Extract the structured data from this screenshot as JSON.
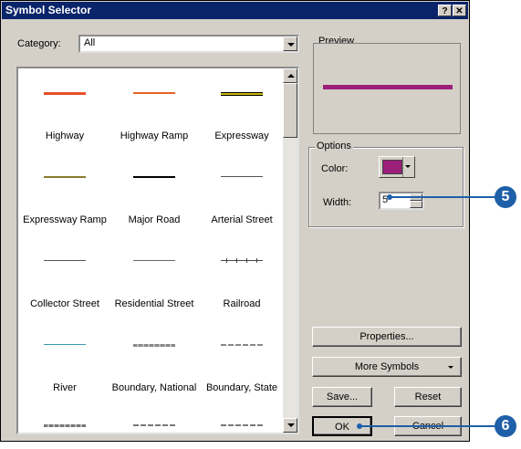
{
  "window": {
    "title": "Symbol Selector",
    "help_btn": "?",
    "close_btn": "✕"
  },
  "category": {
    "label": "Category:",
    "value": "All"
  },
  "symbols": [
    {
      "name": "Highway",
      "color": "#e8502a",
      "style": "thick"
    },
    {
      "name": "Highway Ramp",
      "color": "#e8602a",
      "style": "thin-double"
    },
    {
      "name": "Expressway",
      "color": "#c8b800",
      "style": "cased"
    },
    {
      "name": "Expressway Ramp",
      "color": "#8a7a30",
      "style": "thin-double"
    },
    {
      "name": "Major Road",
      "color": "#000000",
      "style": "medium"
    },
    {
      "name": "Arterial Street",
      "color": "#555555",
      "style": "thin"
    },
    {
      "name": "Collector Street",
      "color": "#555555",
      "style": "thin"
    },
    {
      "name": "Residential Street",
      "color": "#666666",
      "style": "thin"
    },
    {
      "name": "Railroad",
      "color": "#444444",
      "style": "rail"
    },
    {
      "name": "River",
      "color": "#3a9ab0",
      "style": "thin"
    },
    {
      "name": "Boundary, National",
      "color": "#888888",
      "style": "dashed-thick"
    },
    {
      "name": "Boundary, State",
      "color": "#888888",
      "style": "dashed"
    },
    {
      "name": "",
      "color": "#777777",
      "style": "dashed-thick"
    },
    {
      "name": "",
      "color": "#777777",
      "style": "dashed"
    },
    {
      "name": "",
      "color": "#777777",
      "style": "dashed"
    }
  ],
  "preview": {
    "label": "Preview",
    "line_color": "#9c1f7a"
  },
  "options": {
    "label": "Options",
    "color_label": "Color:",
    "color_swatch": "#9c1f7a",
    "width_label": "Width:",
    "width_value": "5"
  },
  "buttons": {
    "properties": "Properties...",
    "more_symbols": "More Symbols",
    "save": "Save...",
    "reset": "Reset",
    "ok": "OK",
    "cancel": "Cancel"
  },
  "callouts": {
    "width_step": "5",
    "ok_step": "6",
    "color": "#1e5fa8"
  }
}
